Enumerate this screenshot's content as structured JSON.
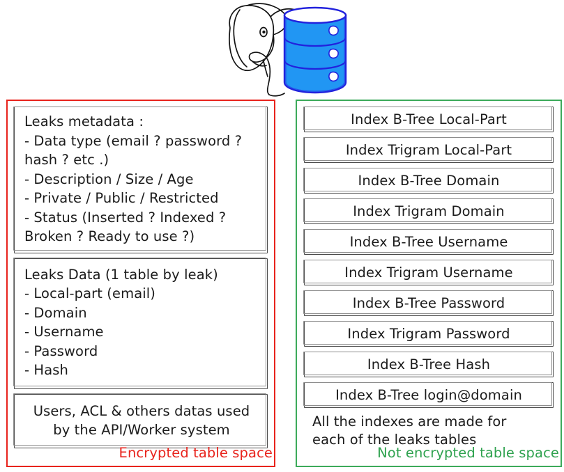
{
  "logo": {
    "name": "postgresql-elephant-database-logo",
    "elephant_icon": "elephant-head-icon",
    "database_icon": "database-cylinder-icon",
    "colors": {
      "cylinder_fill": "#2196f3",
      "cylinder_stroke": "#2222dd",
      "elephant_stroke": "#1a1a1a"
    }
  },
  "encrypted_panel": {
    "border_color": "#e8231c",
    "footer_label": "Encrypted table space",
    "boxes": [
      {
        "name": "leaks-metadata-box",
        "lines": [
          "Leaks metadata :",
          "- Data type (email ? password ?",
          "hash ? etc .)",
          "- Description / Size / Age",
          "- Private / Public / Restricted",
          "- Status (Inserted ? Indexed ?",
          "Broken ? Ready to use ?)"
        ]
      },
      {
        "name": "leaks-data-box",
        "lines": [
          "Leaks Data (1 table by leak)",
          "- Local-part (email)",
          "- Domain",
          "- Username",
          "- Password",
          "- Hash"
        ]
      },
      {
        "name": "users-acl-box",
        "lines": [
          "Users, ACL & others datas used",
          "by the API/Worker system"
        ]
      }
    ]
  },
  "not_encrypted_panel": {
    "border_color": "#3caa5a",
    "footer_label": "Not encrypted table space",
    "indexes": [
      "Index B-Tree Local-Part",
      "Index Trigram Local-Part",
      "Index B-Tree Domain",
      "Index Trigram Domain",
      "Index B-Tree Username",
      "Index Trigram Username",
      "Index B-Tree Password",
      "Index Trigram Password",
      "Index B-Tree Hash",
      "Index B-Tree login@domain"
    ],
    "note_lines": [
      "All the indexes are made for",
      "each of the leaks tables"
    ]
  }
}
